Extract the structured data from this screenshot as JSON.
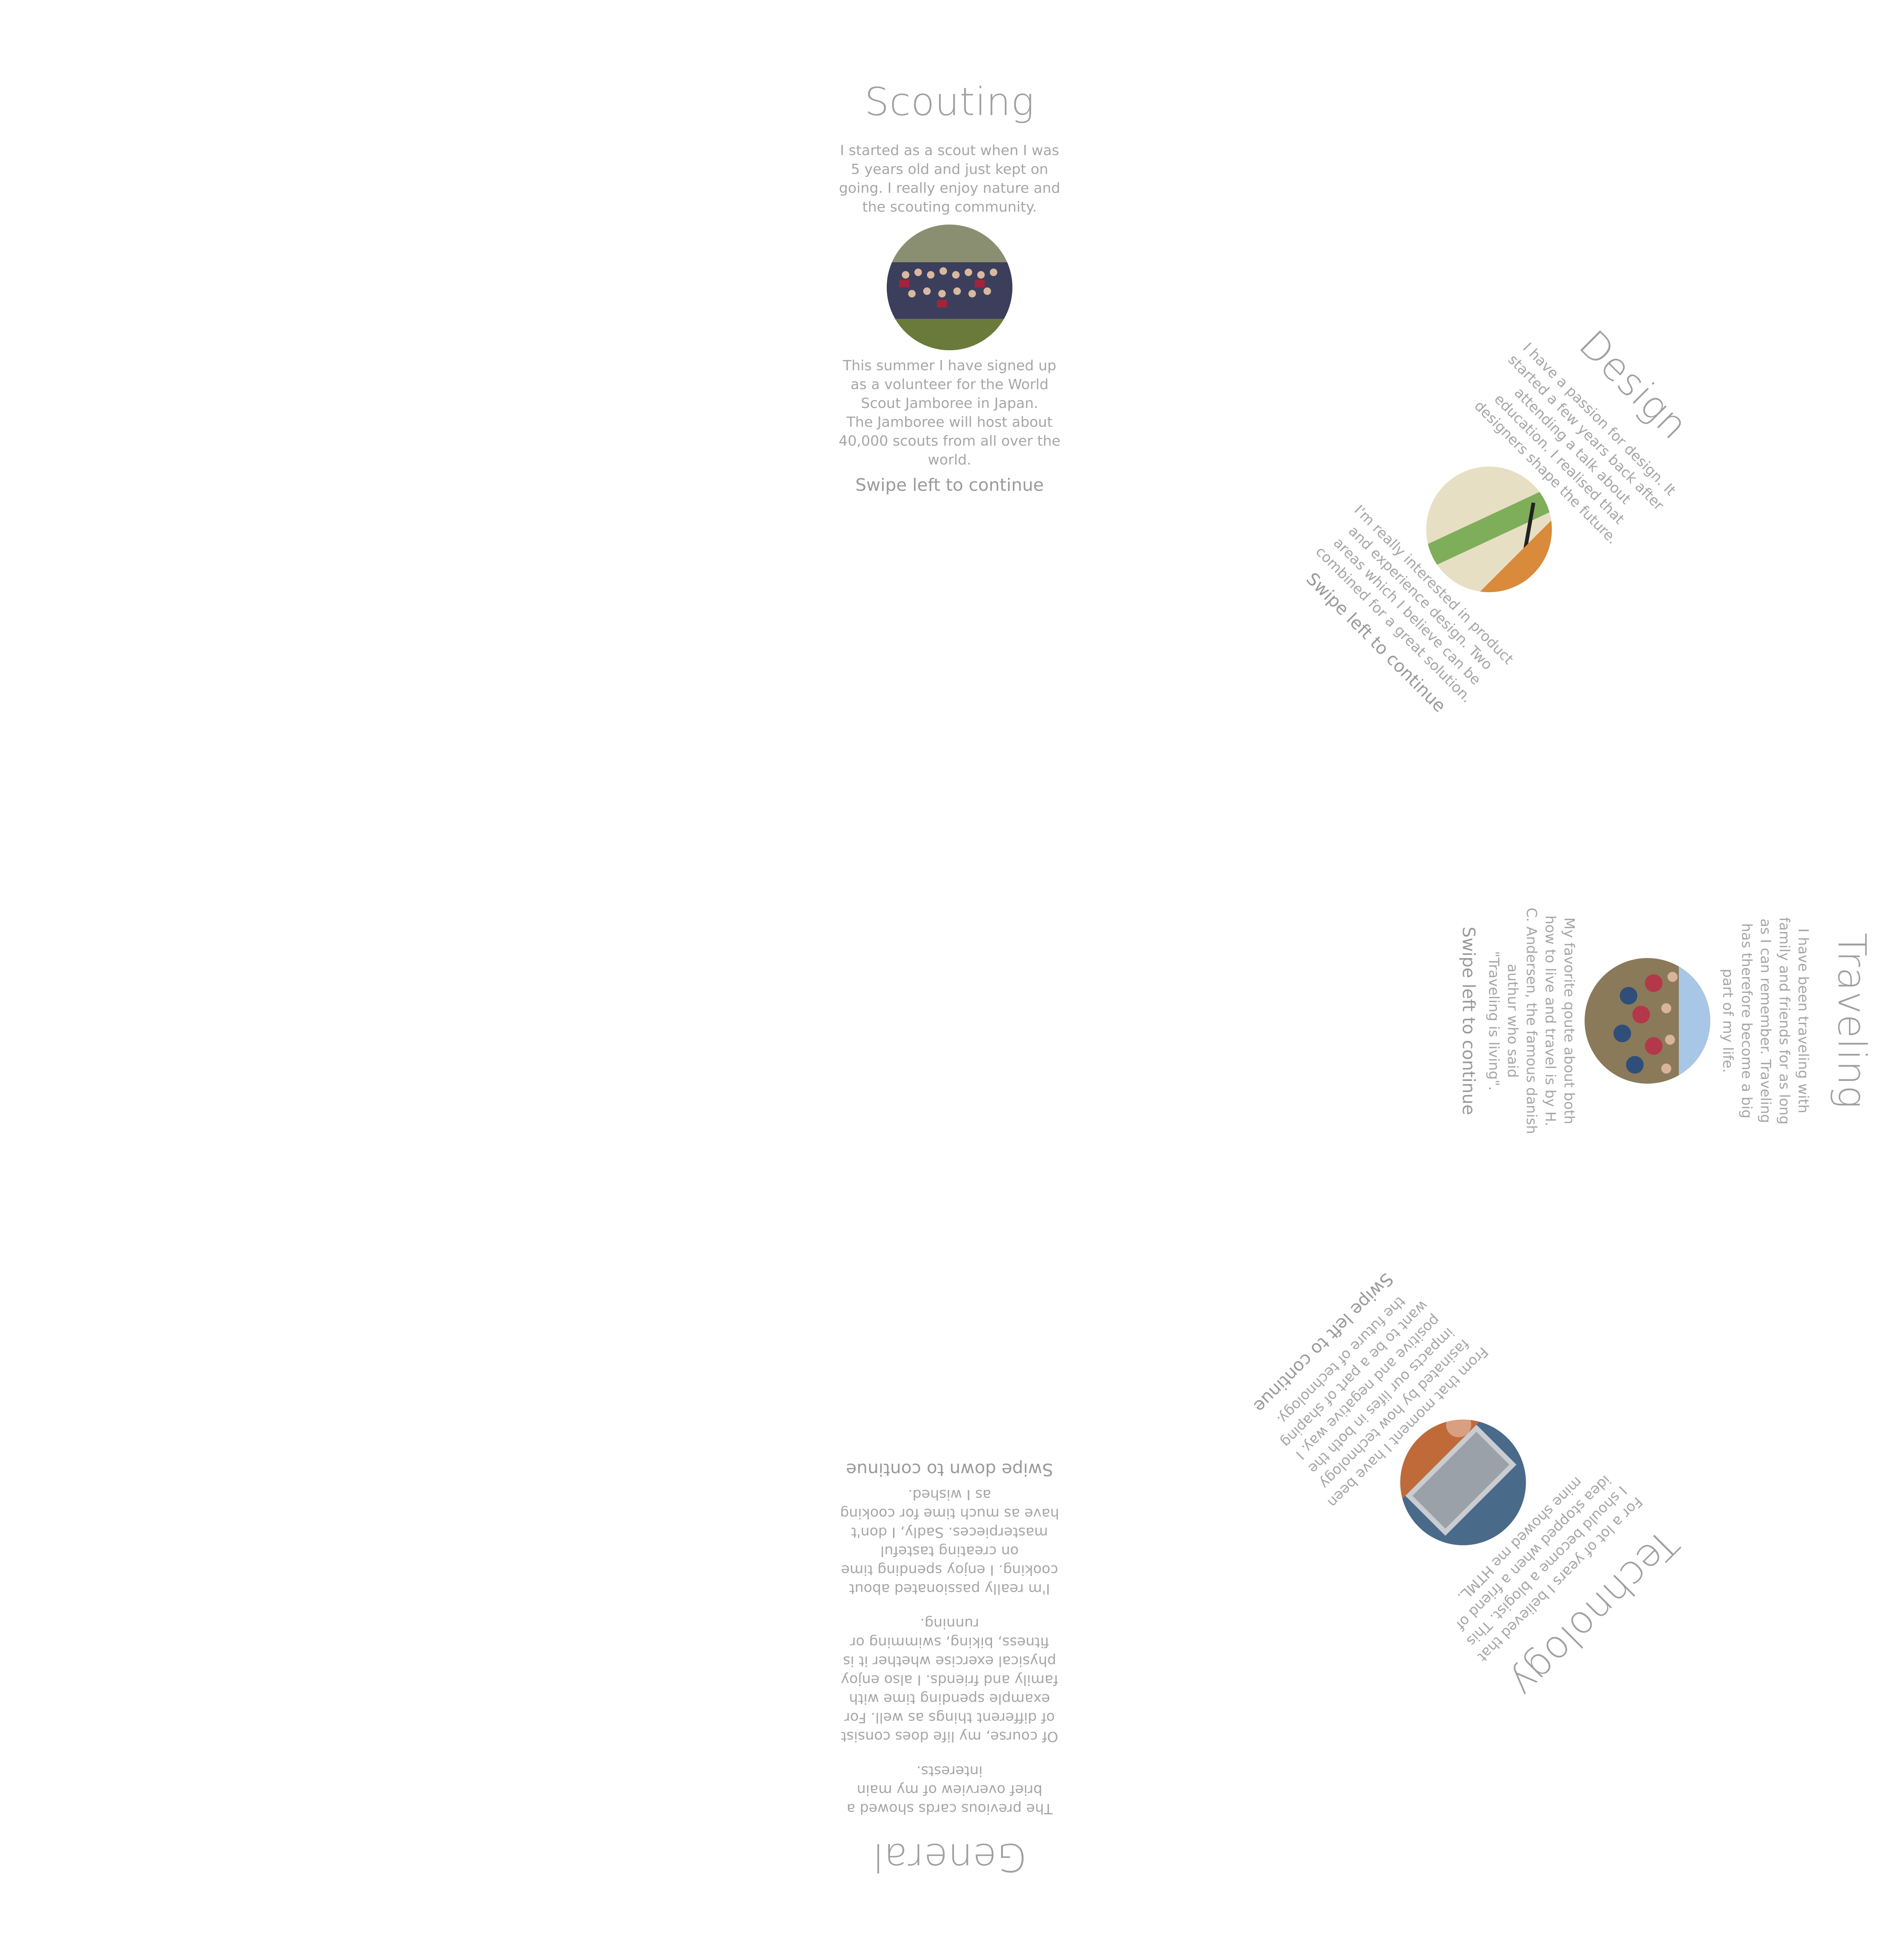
{
  "cards": {
    "scouting": {
      "title": "Scouting",
      "para1": "I started as a scout when I was 5 years old and just kept on going. I really enjoy nature and the scouting community.",
      "para2": "This summer I have signed up as a volunteer for the World Scout Jamboree in Japan.",
      "para3": "The Jamboree will host about 40,000 scouts from all over the world.",
      "swipe": "Swipe left to continue",
      "photo_icon": "group-photo"
    },
    "design": {
      "title": "Design",
      "para1": "I have a passion for design. It started a few years back after attending a talk about education. I realised that designers shape the future.",
      "para2": "I'm really interested in product and experience design. Two areas which I believe can be combined for a great solution.",
      "swipe": "Swipe left to continue",
      "photo_icon": "ruler-pen-photo"
    },
    "traveling": {
      "title": "Traveling",
      "para1": "I have been traveling with family and friends for as long as I can remember. Traveling has therefore become a big part of my life.",
      "para2": "My favorite qoute about both how to live and travel is by H. C. Andersen, the famous danish authur who said",
      "para3": "\"Traveling is living\".",
      "swipe": "Swipe left to continue",
      "photo_icon": "crowd-photo"
    },
    "technology": {
      "title": "Technology",
      "para1": "For a lot of years I believed that I should become a blogist. This idea stopped when a friend of mine showed me HTML.",
      "para2": "From that moment I have been fasinated by how technology impacts our lifes in both the positive and negative way. I want to be a part of shaping the future of technology.",
      "swipe": "Swipe left to continue",
      "photo_icon": "laptop-photo"
    },
    "general": {
      "title": "General",
      "para1": "The previous cards showed a brief overview of my main interests.",
      "para2": "Of course, my life does consist of different things as well. For example spending time with family and friends. I also enjoy physical exercise whether it is fitness, biking, swimming or running.",
      "para3": "I'm really passionated about cooking. I enjoy spending time on creating tasteful masterpieces. Sadly, I don't have as much time for cooking as I wished.",
      "swipe": "Swipe down to continue"
    }
  }
}
